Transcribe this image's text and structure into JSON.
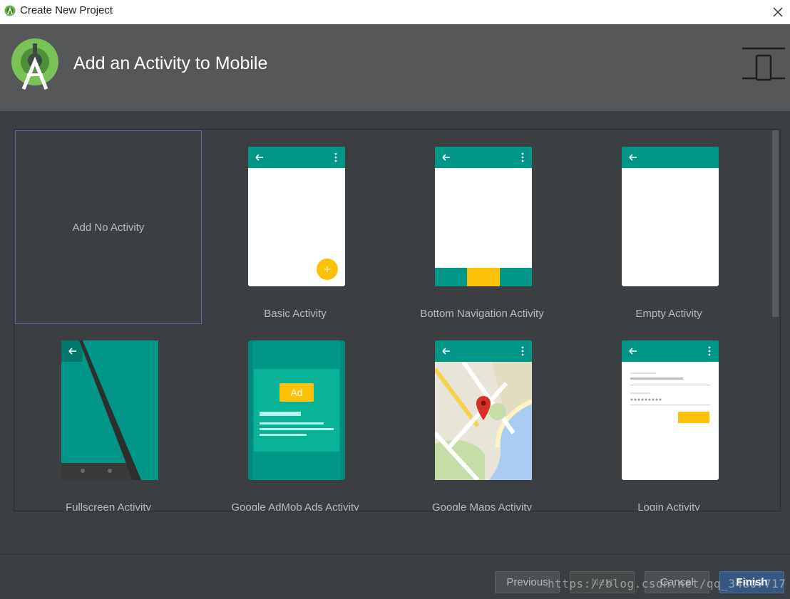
{
  "window": {
    "title": "Create New Project"
  },
  "header": {
    "heading": "Add an Activity to Mobile"
  },
  "gallery": {
    "no_activity_label": "Add No Activity",
    "activities": [
      {
        "label": "Basic Activity"
      },
      {
        "label": "Bottom Navigation Activity"
      },
      {
        "label": "Empty Activity"
      },
      {
        "label": "Fullscreen Activity"
      },
      {
        "label": "Google AdMob Ads Activity"
      },
      {
        "label": "Google Maps Activity"
      },
      {
        "label": "Login Activity"
      }
    ],
    "admob_badge": "Ad"
  },
  "footer": {
    "previous_label": "Previous",
    "next_label": "Next",
    "cancel_label": "Cancel",
    "finish_label": "Finish"
  },
  "watermark": "https://blog.csdn.net/qq_34807717",
  "colors": {
    "teal": "#009688",
    "accent_yellow": "#ffc107",
    "dialog_bg": "#3c3f41",
    "header_bg": "#555759",
    "selection_border": "#4b6eaf"
  }
}
